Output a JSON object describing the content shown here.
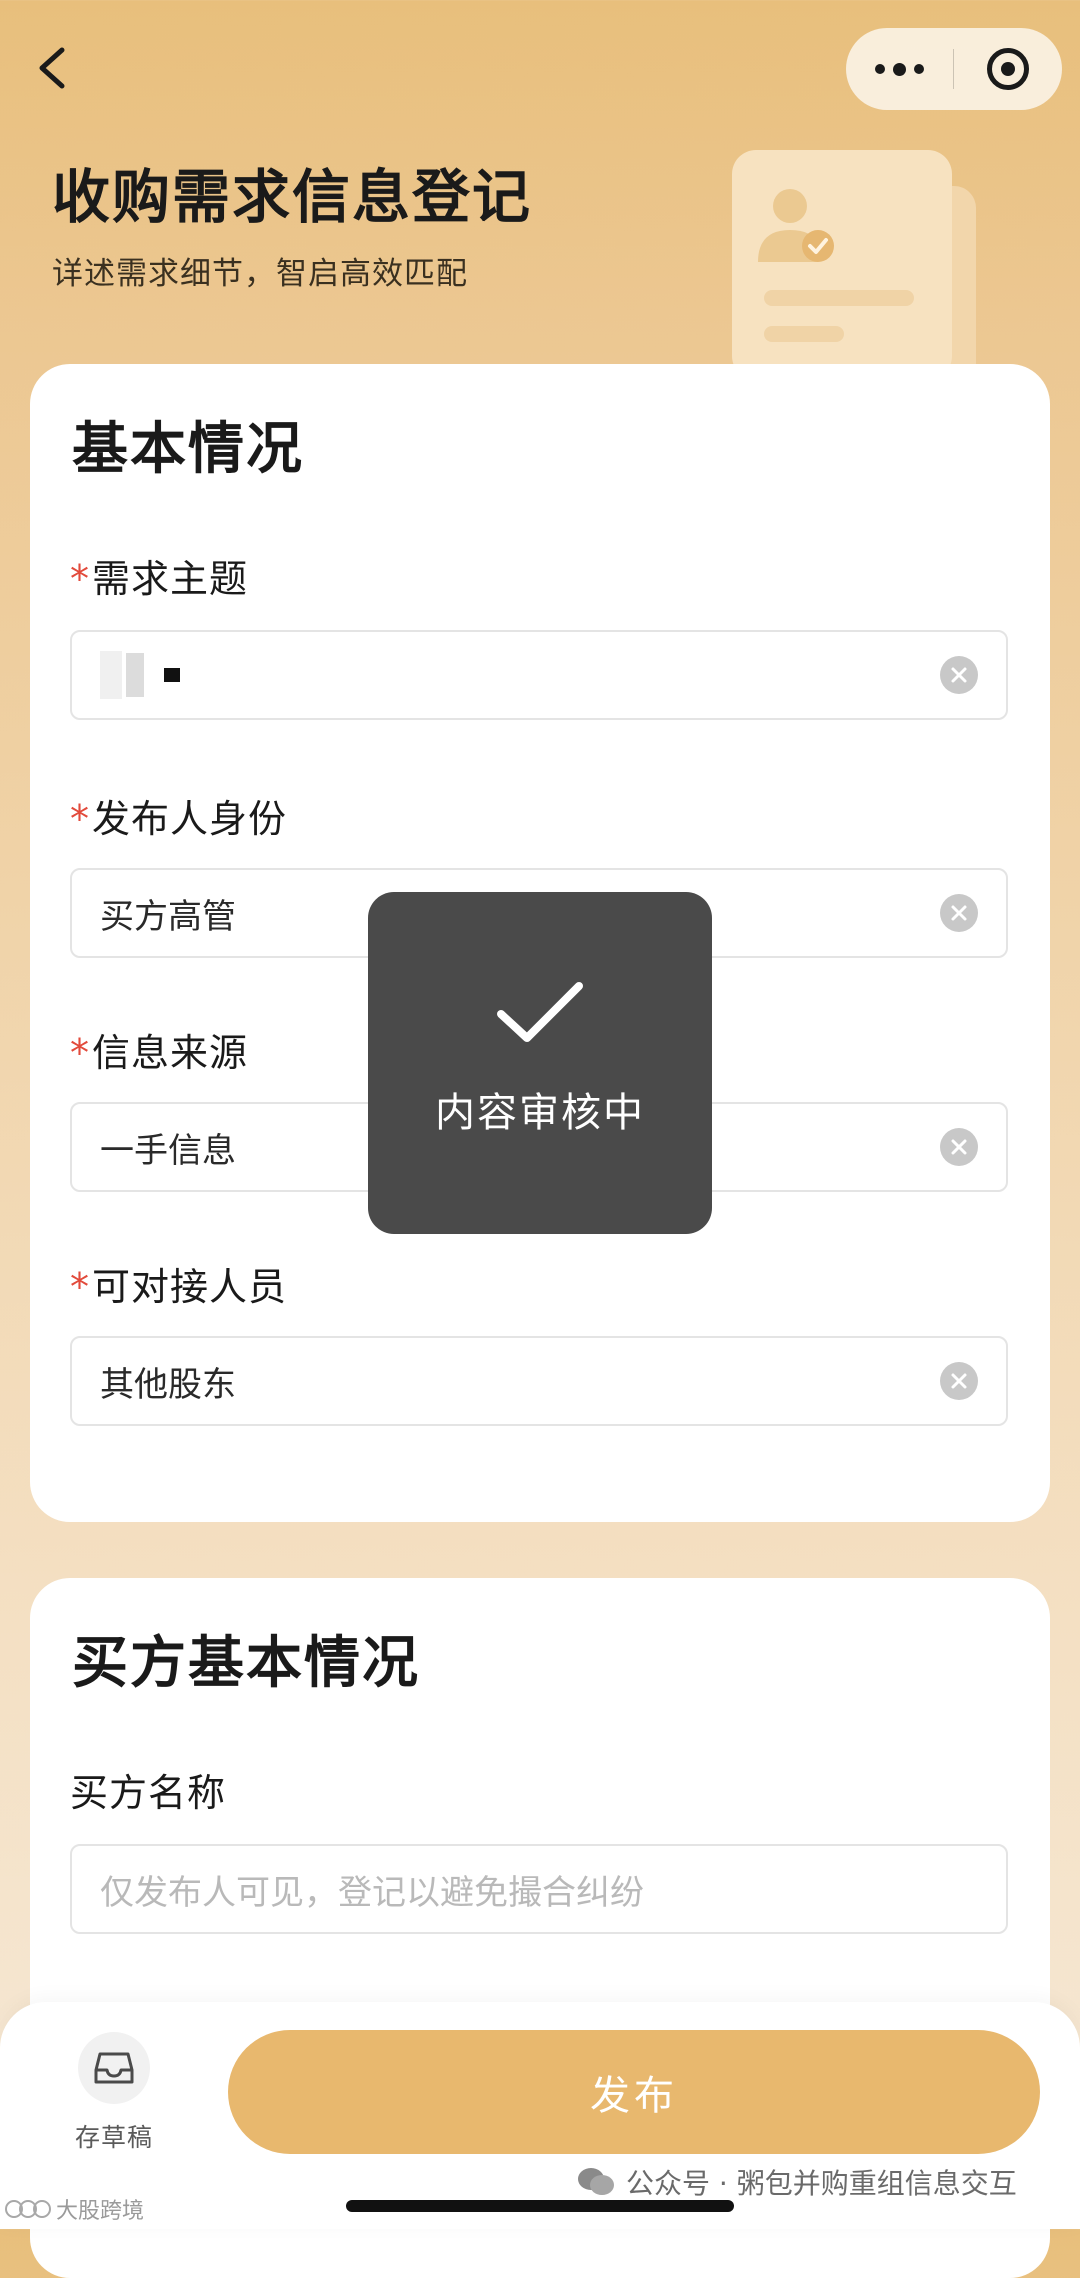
{
  "header": {
    "title": "收购需求信息登记",
    "subtitle": "详述需求细节，智启高效匹配"
  },
  "basic_section": {
    "title": "基本情况",
    "fields": [
      {
        "label": "需求主题",
        "required": "*",
        "value": ""
      },
      {
        "label": "发布人身份",
        "required": "*",
        "value": "买方高管"
      },
      {
        "label": "信息来源",
        "required": "*",
        "value": "一手信息"
      },
      {
        "label": "可对接人员",
        "required": "*",
        "value": "其他股东"
      }
    ]
  },
  "buyer_section": {
    "title": "买方基本情况",
    "fields": [
      {
        "label": "买方名称",
        "placeholder": "仅发布人可见，登记以避免撮合纠纷"
      }
    ]
  },
  "toast": {
    "message": "内容审核中",
    "icon": "checkmark-icon"
  },
  "bottom_bar": {
    "draft_label": "存草稿",
    "draft_icon": "inbox-icon",
    "publish_label": "发布"
  },
  "watermark": {
    "right": "公众号 · 粥包并购重组信息交互",
    "left": "大股跨境"
  },
  "colors": {
    "accent": "#e8b86e",
    "required_star": "#e24a3b",
    "toast_bg": "#4a4a4a"
  }
}
